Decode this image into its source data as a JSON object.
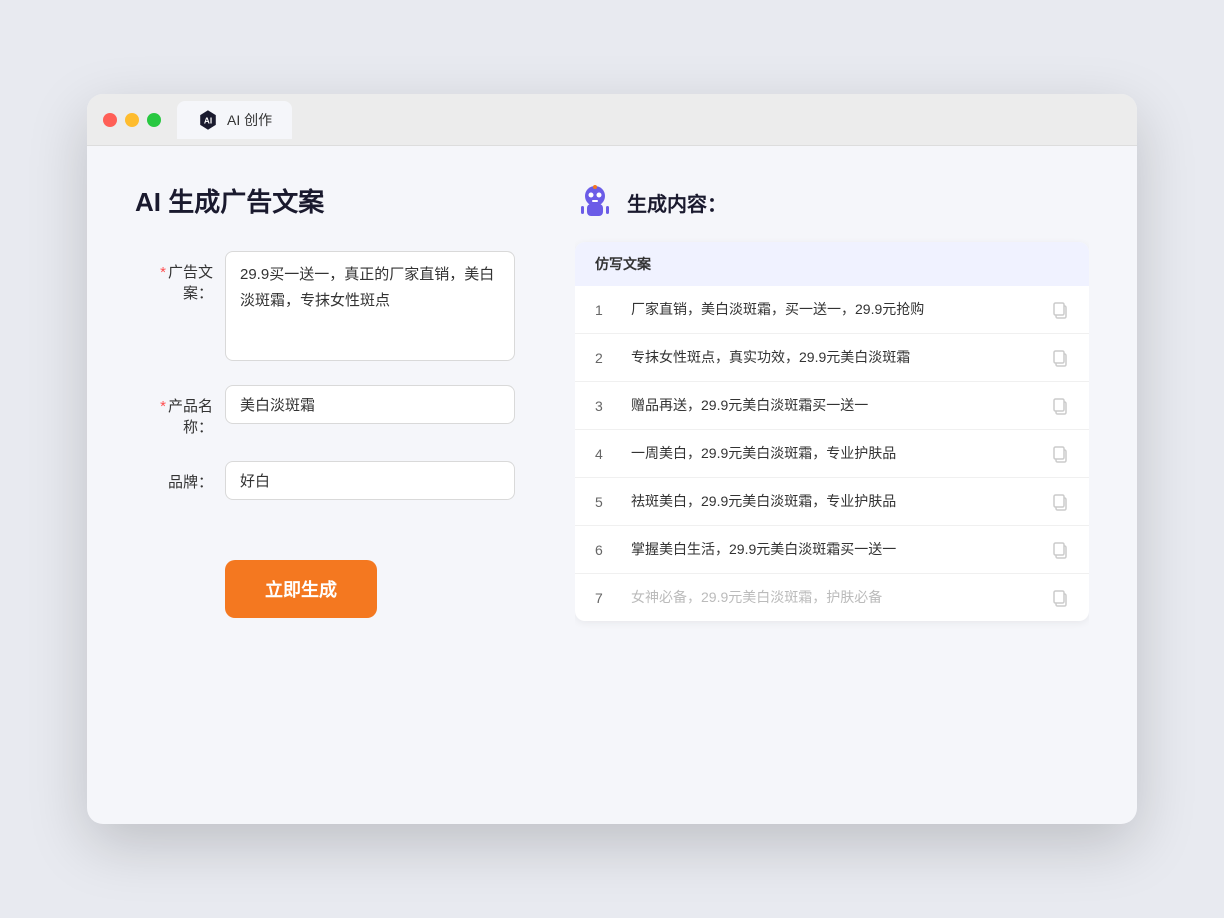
{
  "window": {
    "tab_label": "AI 创作"
  },
  "page": {
    "title": "AI 生成广告文案"
  },
  "form": {
    "ad_copy_label": "广告文案：",
    "ad_copy_required": "*",
    "ad_copy_value": "29.9买一送一，真正的厂家直销，美白淡斑霜，专抹女性斑点",
    "product_name_label": "产品名称：",
    "product_name_required": "*",
    "product_name_value": "美白淡斑霜",
    "brand_label": "品牌：",
    "brand_value": "好白",
    "generate_button": "立即生成"
  },
  "result": {
    "header": "生成内容：",
    "column_header": "仿写文案",
    "items": [
      {
        "num": "1",
        "text": "厂家直销，美白淡斑霜，买一送一，29.9元抢购",
        "faded": false
      },
      {
        "num": "2",
        "text": "专抹女性斑点，真实功效，29.9元美白淡斑霜",
        "faded": false
      },
      {
        "num": "3",
        "text": "赠品再送，29.9元美白淡斑霜买一送一",
        "faded": false
      },
      {
        "num": "4",
        "text": "一周美白，29.9元美白淡斑霜，专业护肤品",
        "faded": false
      },
      {
        "num": "5",
        "text": "祛斑美白，29.9元美白淡斑霜，专业护肤品",
        "faded": false
      },
      {
        "num": "6",
        "text": "掌握美白生活，29.9元美白淡斑霜买一送一",
        "faded": false
      },
      {
        "num": "7",
        "text": "女神必备，29.9元美白淡斑霜，护肤必备",
        "faded": true
      }
    ]
  }
}
